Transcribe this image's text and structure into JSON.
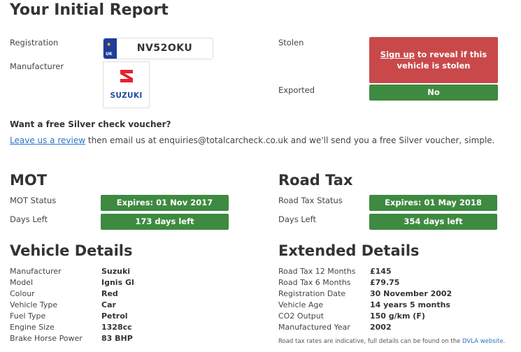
{
  "report": {
    "title": "Your Initial Report",
    "registration_label": "Registration",
    "registration": "NV52OKU",
    "plate_country": "UK",
    "manufacturer_label": "Manufacturer",
    "manufacturer_logo_text": "SUZUKI",
    "stolen_label": "Stolen",
    "stolen_signup": "Sign up",
    "stolen_text": " to reveal if this vehicle is stolen",
    "exported_label": "Exported",
    "exported_value": "No"
  },
  "voucher": {
    "question": "Want a free Silver check voucher?",
    "link": "Leave us a review",
    "text": " then email us at enquiries@totalcarcheck.co.uk and we'll send you a free Silver voucher, simple."
  },
  "mot": {
    "title": "MOT",
    "status_label": "MOT Status",
    "status_value": "Expires: 01 Nov 2017",
    "days_label": "Days Left",
    "days_value": "173 days left"
  },
  "road_tax": {
    "title": "Road Tax",
    "status_label": "Road Tax Status",
    "status_value": "Expires: 01 May 2018",
    "days_label": "Days Left",
    "days_value": "354 days left"
  },
  "vehicle_details": {
    "title": "Vehicle Details",
    "rows": [
      {
        "label": "Manufacturer",
        "value": "Suzuki"
      },
      {
        "label": "Model",
        "value": "Ignis Gl"
      },
      {
        "label": "Colour",
        "value": "Red"
      },
      {
        "label": "Vehicle Type",
        "value": "Car"
      },
      {
        "label": "Fuel Type",
        "value": "Petrol"
      },
      {
        "label": "Engine Size",
        "value": "1328cc"
      },
      {
        "label": "Brake Horse Power",
        "value": "83 BHP"
      }
    ]
  },
  "extended_details": {
    "title": "Extended Details",
    "rows": [
      {
        "label": "Road Tax 12 Months",
        "value": "£145"
      },
      {
        "label": "Road Tax 6 Months",
        "value": "£79.75"
      },
      {
        "label": "Registration Date",
        "value": "30 November 2002"
      },
      {
        "label": "Vehicle Age",
        "value": "14 years 5 months"
      },
      {
        "label": "CO2 Output",
        "value": "150 g/km (F)"
      },
      {
        "label": "Manufactured Year",
        "value": "2002"
      }
    ],
    "note_text": "Road tax rates are indicative, full details can be found on the ",
    "note_link": "DVLA website",
    "note_end": "."
  },
  "colors": {
    "green": "#3e8a40",
    "red": "#c9494a",
    "link": "#2a73c7",
    "suzuki_red": "#e3232b",
    "suzuki_blue": "#1c4fa0"
  }
}
